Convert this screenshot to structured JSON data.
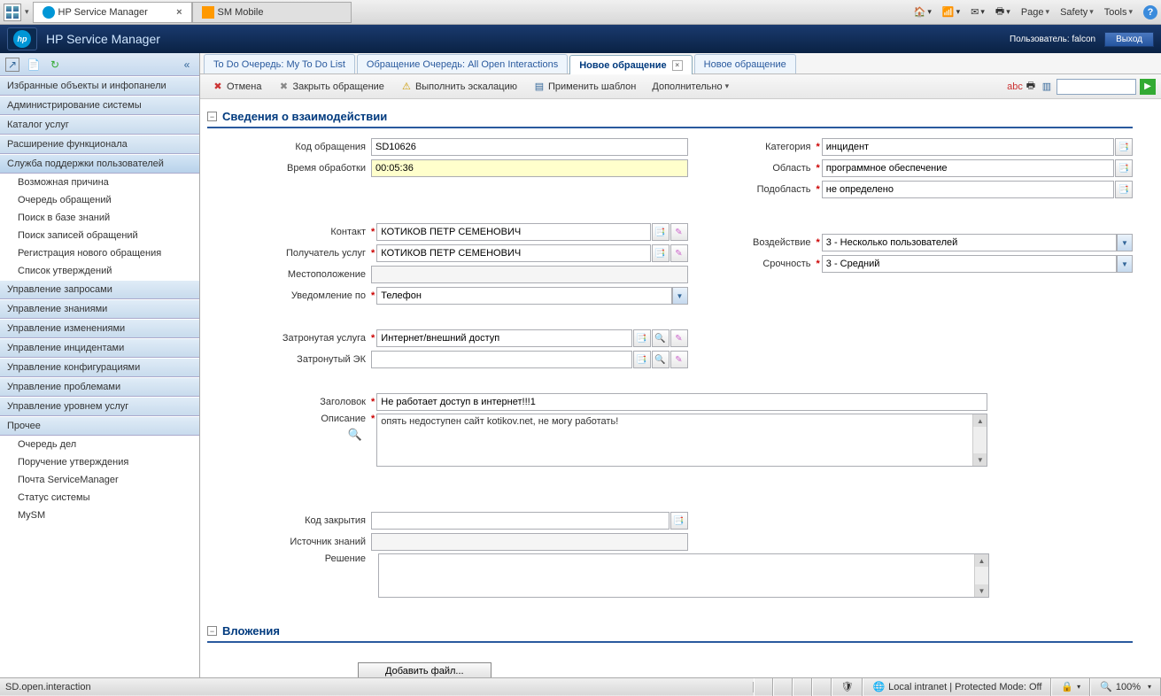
{
  "browser": {
    "tabs": [
      {
        "title": "HP Service Manager",
        "active": true
      },
      {
        "title": "SM Mobile",
        "active": false
      }
    ],
    "menu": {
      "page": "Page",
      "safety": "Safety",
      "tools": "Tools"
    }
  },
  "header": {
    "title": "HP Service Manager",
    "user_label": "Пользователь: falcon",
    "exit": "Выход"
  },
  "sidebar": {
    "sections": [
      {
        "label": "Избранные объекты и инфопанели",
        "children": []
      },
      {
        "label": "Администрирование системы",
        "children": []
      },
      {
        "label": "Каталог услуг",
        "children": []
      },
      {
        "label": "Расширение функционала",
        "children": []
      },
      {
        "label": "Служба поддержки пользователей",
        "children": [
          {
            "label": "Возможная причина"
          },
          {
            "label": "Очередь обращений"
          },
          {
            "label": "Поиск в базе знаний"
          },
          {
            "label": "Поиск записей обращений"
          },
          {
            "label": "Регистрация нового обращения"
          },
          {
            "label": "Список утверждений"
          }
        ]
      },
      {
        "label": "Управление запросами",
        "children": []
      },
      {
        "label": "Управление знаниями",
        "children": []
      },
      {
        "label": "Управление изменениями",
        "children": []
      },
      {
        "label": "Управление инцидентами",
        "children": []
      },
      {
        "label": "Управление конфигурациями",
        "children": []
      },
      {
        "label": "Управление проблемами",
        "children": []
      },
      {
        "label": "Управление уровнем услуг",
        "children": []
      },
      {
        "label": "Прочее",
        "children": [
          {
            "label": "Очередь дел"
          },
          {
            "label": "Поручение утверждения"
          },
          {
            "label": "Почта ServiceManager"
          },
          {
            "label": "Статус системы"
          },
          {
            "label": "MySM"
          }
        ]
      }
    ]
  },
  "tabs": [
    {
      "label": "To Do Очередь: My To Do List",
      "active": false,
      "closeable": false
    },
    {
      "label": "Обращение Очередь: All Open Interactions",
      "active": false,
      "closeable": false
    },
    {
      "label": "Новое обращение",
      "active": true,
      "closeable": true
    },
    {
      "label": "Новое обращение",
      "active": false,
      "closeable": false
    }
  ],
  "actions": {
    "cancel": "Отмена",
    "close": "Закрыть обращение",
    "escalate": "Выполнить эскалацию",
    "template": "Применить шаблон",
    "more": "Дополнительно"
  },
  "section1": "Сведения о взаимодействии",
  "section2": "Вложения",
  "fields": {
    "id_label": "Код обращения",
    "id_value": "SD10626",
    "elapsed_label": "Время обработки",
    "elapsed_value": "00:05:36",
    "category_label": "Категория",
    "category_value": "инцидент",
    "area_label": "Область",
    "area_value": "программное обеспечение",
    "subarea_label": "Подобласть",
    "subarea_value": "не определено",
    "contact_label": "Контакт",
    "contact_value": "КОТИКОВ ПЕТР СЕМЕНОВИЧ",
    "recipient_label": "Получатель услуг",
    "recipient_value": "КОТИКОВ ПЕТР СЕМЕНОВИЧ",
    "location_label": "Местоположение",
    "location_value": "",
    "notify_label": "Уведомление по",
    "notify_value": "Телефон",
    "impact_label": "Воздействие",
    "impact_value": "3 - Несколько пользователей",
    "urgency_label": "Срочность",
    "urgency_value": "3 - Средний",
    "service_label": "Затронутая услуга",
    "service_value": "Интернет/внешний доступ",
    "ci_label": "Затронутый ЭК",
    "ci_value": "",
    "title_label": "Заголовок",
    "title_value": "Не работает доступ в интернет!!!1",
    "desc_label": "Описание",
    "desc_value": "опять недоступен сайт kotikov.net, не могу работать!",
    "closure_label": "Код закрытия",
    "closure_value": "",
    "knowledge_label": "Источник знаний",
    "knowledge_value": "",
    "resolution_label": "Решение",
    "resolution_value": "",
    "addfile": "Добавить файл..."
  },
  "status": {
    "left": "SD.open.interaction",
    "zone": "Local intranet | Protected Mode: Off",
    "zoom": "100%"
  }
}
